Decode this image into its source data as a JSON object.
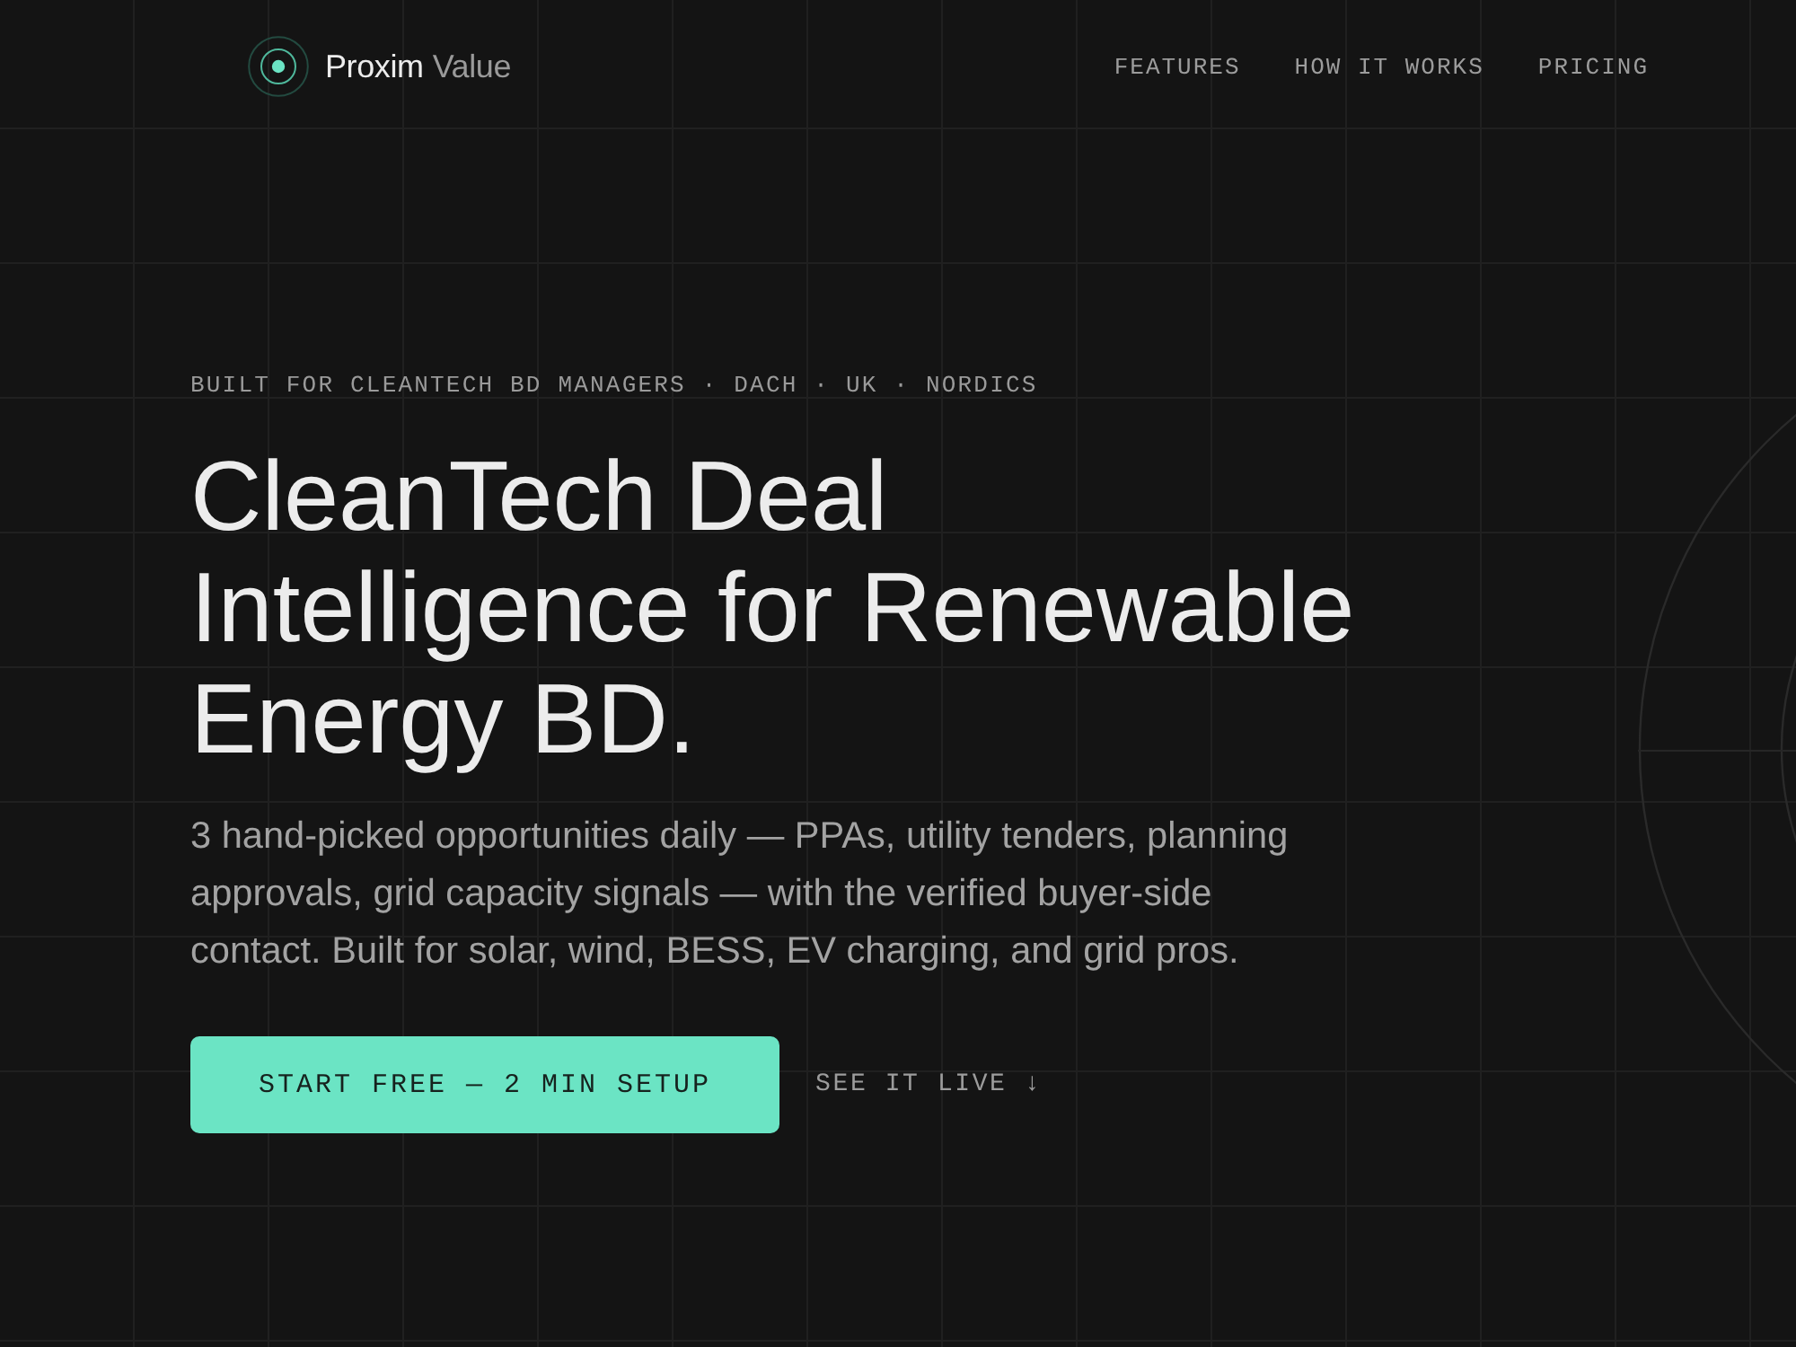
{
  "nav": {
    "brand": {
      "primary": "Proxim",
      "secondary": "Value"
    },
    "links": [
      {
        "label": "FEATURES"
      },
      {
        "label": "HOW IT WORKS"
      },
      {
        "label": "PRICING"
      }
    ]
  },
  "hero": {
    "eyebrow": "BUILT FOR CLEANTECH BD MANAGERS · DACH · UK · NORDICS",
    "heading": "CleanTech Deal Intelligence for Renewable Energy BD.",
    "description": "3 hand-picked opportunities daily — PPAs, utility tenders, planning approvals, grid capacity signals — with the verified buyer-side contact. Built for solar, wind, BESS, EV charging, and grid pros.",
    "actions": [
      {
        "kind": "primary",
        "label": "START FREE — 2 MIN SETUP"
      },
      {
        "kind": "link",
        "label": "SEE IT LIVE ↓"
      }
    ]
  }
}
